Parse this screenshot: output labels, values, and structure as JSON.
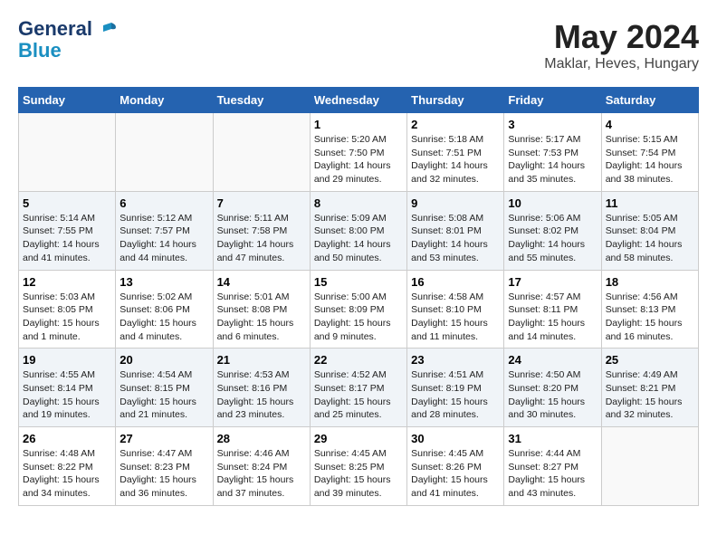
{
  "header": {
    "logo_line1": "General",
    "logo_line2": "Blue",
    "title": "May 2024",
    "subtitle": "Maklar, Heves, Hungary"
  },
  "weekdays": [
    "Sunday",
    "Monday",
    "Tuesday",
    "Wednesday",
    "Thursday",
    "Friday",
    "Saturday"
  ],
  "weeks": [
    [
      {
        "day": "",
        "info": ""
      },
      {
        "day": "",
        "info": ""
      },
      {
        "day": "",
        "info": ""
      },
      {
        "day": "1",
        "info": "Sunrise: 5:20 AM\nSunset: 7:50 PM\nDaylight: 14 hours\nand 29 minutes."
      },
      {
        "day": "2",
        "info": "Sunrise: 5:18 AM\nSunset: 7:51 PM\nDaylight: 14 hours\nand 32 minutes."
      },
      {
        "day": "3",
        "info": "Sunrise: 5:17 AM\nSunset: 7:53 PM\nDaylight: 14 hours\nand 35 minutes."
      },
      {
        "day": "4",
        "info": "Sunrise: 5:15 AM\nSunset: 7:54 PM\nDaylight: 14 hours\nand 38 minutes."
      }
    ],
    [
      {
        "day": "5",
        "info": "Sunrise: 5:14 AM\nSunset: 7:55 PM\nDaylight: 14 hours\nand 41 minutes."
      },
      {
        "day": "6",
        "info": "Sunrise: 5:12 AM\nSunset: 7:57 PM\nDaylight: 14 hours\nand 44 minutes."
      },
      {
        "day": "7",
        "info": "Sunrise: 5:11 AM\nSunset: 7:58 PM\nDaylight: 14 hours\nand 47 minutes."
      },
      {
        "day": "8",
        "info": "Sunrise: 5:09 AM\nSunset: 8:00 PM\nDaylight: 14 hours\nand 50 minutes."
      },
      {
        "day": "9",
        "info": "Sunrise: 5:08 AM\nSunset: 8:01 PM\nDaylight: 14 hours\nand 53 minutes."
      },
      {
        "day": "10",
        "info": "Sunrise: 5:06 AM\nSunset: 8:02 PM\nDaylight: 14 hours\nand 55 minutes."
      },
      {
        "day": "11",
        "info": "Sunrise: 5:05 AM\nSunset: 8:04 PM\nDaylight: 14 hours\nand 58 minutes."
      }
    ],
    [
      {
        "day": "12",
        "info": "Sunrise: 5:03 AM\nSunset: 8:05 PM\nDaylight: 15 hours\nand 1 minute."
      },
      {
        "day": "13",
        "info": "Sunrise: 5:02 AM\nSunset: 8:06 PM\nDaylight: 15 hours\nand 4 minutes."
      },
      {
        "day": "14",
        "info": "Sunrise: 5:01 AM\nSunset: 8:08 PM\nDaylight: 15 hours\nand 6 minutes."
      },
      {
        "day": "15",
        "info": "Sunrise: 5:00 AM\nSunset: 8:09 PM\nDaylight: 15 hours\nand 9 minutes."
      },
      {
        "day": "16",
        "info": "Sunrise: 4:58 AM\nSunset: 8:10 PM\nDaylight: 15 hours\nand 11 minutes."
      },
      {
        "day": "17",
        "info": "Sunrise: 4:57 AM\nSunset: 8:11 PM\nDaylight: 15 hours\nand 14 minutes."
      },
      {
        "day": "18",
        "info": "Sunrise: 4:56 AM\nSunset: 8:13 PM\nDaylight: 15 hours\nand 16 minutes."
      }
    ],
    [
      {
        "day": "19",
        "info": "Sunrise: 4:55 AM\nSunset: 8:14 PM\nDaylight: 15 hours\nand 19 minutes."
      },
      {
        "day": "20",
        "info": "Sunrise: 4:54 AM\nSunset: 8:15 PM\nDaylight: 15 hours\nand 21 minutes."
      },
      {
        "day": "21",
        "info": "Sunrise: 4:53 AM\nSunset: 8:16 PM\nDaylight: 15 hours\nand 23 minutes."
      },
      {
        "day": "22",
        "info": "Sunrise: 4:52 AM\nSunset: 8:17 PM\nDaylight: 15 hours\nand 25 minutes."
      },
      {
        "day": "23",
        "info": "Sunrise: 4:51 AM\nSunset: 8:19 PM\nDaylight: 15 hours\nand 28 minutes."
      },
      {
        "day": "24",
        "info": "Sunrise: 4:50 AM\nSunset: 8:20 PM\nDaylight: 15 hours\nand 30 minutes."
      },
      {
        "day": "25",
        "info": "Sunrise: 4:49 AM\nSunset: 8:21 PM\nDaylight: 15 hours\nand 32 minutes."
      }
    ],
    [
      {
        "day": "26",
        "info": "Sunrise: 4:48 AM\nSunset: 8:22 PM\nDaylight: 15 hours\nand 34 minutes."
      },
      {
        "day": "27",
        "info": "Sunrise: 4:47 AM\nSunset: 8:23 PM\nDaylight: 15 hours\nand 36 minutes."
      },
      {
        "day": "28",
        "info": "Sunrise: 4:46 AM\nSunset: 8:24 PM\nDaylight: 15 hours\nand 37 minutes."
      },
      {
        "day": "29",
        "info": "Sunrise: 4:45 AM\nSunset: 8:25 PM\nDaylight: 15 hours\nand 39 minutes."
      },
      {
        "day": "30",
        "info": "Sunrise: 4:45 AM\nSunset: 8:26 PM\nDaylight: 15 hours\nand 41 minutes."
      },
      {
        "day": "31",
        "info": "Sunrise: 4:44 AM\nSunset: 8:27 PM\nDaylight: 15 hours\nand 43 minutes."
      },
      {
        "day": "",
        "info": ""
      }
    ]
  ]
}
